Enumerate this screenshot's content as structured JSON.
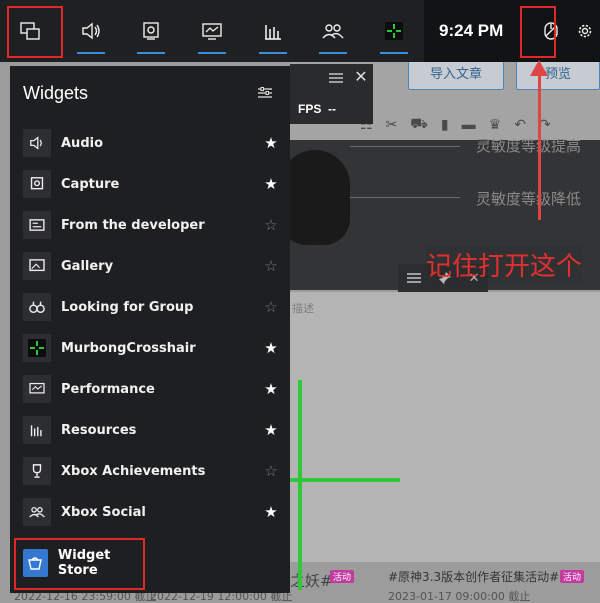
{
  "background": {
    "buttons": [
      "导入文章",
      "预览"
    ],
    "notes": [
      "灵敏度等级提高",
      "灵敏度等级降低"
    ],
    "desc_label": "描述",
    "bottom_texts": [
      "2022-12-16 23:59:00 截止",
      "2022-12-19 12:00:00 截止",
      "#原神3.3版本创作者征集活动#",
      "2023-01-17 09:00:00 截止"
    ],
    "badge": "活动",
    "fps_label": "FPS",
    "fps_value": "--",
    "bg_fragment": "之妖#"
  },
  "gamebar": {
    "buttons": [
      {
        "name": "widget-menu",
        "icon": "widget-menu-icon"
      },
      {
        "name": "audio",
        "icon": "speaker-icon"
      },
      {
        "name": "capture",
        "icon": "camera-icon"
      },
      {
        "name": "performance",
        "icon": "monitor-icon"
      },
      {
        "name": "resources",
        "icon": "bar-chart-icon"
      },
      {
        "name": "xbox-social",
        "icon": "people-icon"
      },
      {
        "name": "crosshair",
        "icon": "crosshair-icon"
      }
    ],
    "time": "9:24 PM"
  },
  "panel": {
    "title": "Widgets",
    "items": [
      {
        "label": "Audio",
        "icon": "speaker-icon",
        "favorite": true
      },
      {
        "label": "Capture",
        "icon": "camera-icon",
        "favorite": true
      },
      {
        "label": "From the developer",
        "icon": "developer-icon",
        "favorite": false
      },
      {
        "label": "Gallery",
        "icon": "gallery-icon",
        "favorite": false
      },
      {
        "label": "Looking for Group",
        "icon": "binoculars-icon",
        "favorite": false
      },
      {
        "label": "MurbongCrosshair",
        "icon": "crosshair-icon",
        "favorite": true
      },
      {
        "label": "Performance",
        "icon": "monitor-icon",
        "favorite": true
      },
      {
        "label": "Resources",
        "icon": "bar-chart-icon",
        "favorite": true
      },
      {
        "label": "Xbox Achievements",
        "icon": "trophy-icon",
        "favorite": false
      },
      {
        "label": "Xbox Social",
        "icon": "people-icon",
        "favorite": true
      }
    ],
    "store_label": "Widget Store"
  },
  "annotation": {
    "note": "记住打开这个",
    "color": "#e02828"
  },
  "colors": {
    "accent": "#3b8dd9",
    "crosshair": "#2ec93a"
  }
}
